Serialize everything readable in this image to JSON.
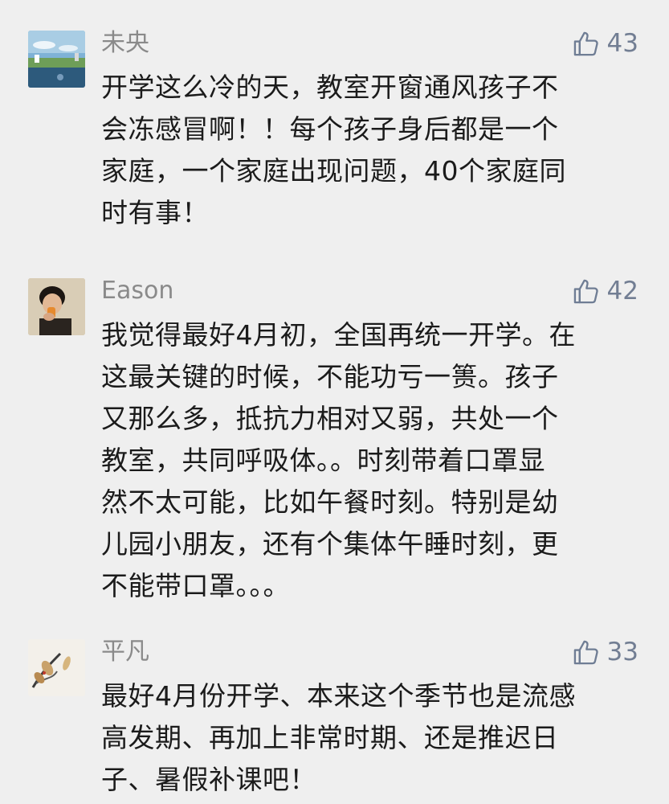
{
  "comments": [
    {
      "username": "未央",
      "likes": "43",
      "avatar": "landscape-sky-avatar",
      "lines": [
        "开学这么冷的天，教室开窗通风孩子不",
        "会冻感冒啊！！每个孩子身后都是一个",
        "家庭，一个家庭出现问题，40个家庭同",
        "时有事！"
      ]
    },
    {
      "username": "Eason",
      "likes": "42",
      "avatar": "person-drinking-avatar",
      "lines": [
        "我觉得最好4月初，全国再统一开学。在",
        "这最关键的时候，不能功亏一篑。孩子",
        "又那么多，抵抗力相对又弱，共处一个",
        "教室，共同呼吸体。。时刻带着口罩显",
        "然不太可能，比如午餐时刻。特别是幼",
        "儿园小朋友，还有个集体午睡时刻，更",
        "不能带口罩。。。"
      ]
    },
    {
      "username": "平凡",
      "likes": "33",
      "avatar": "ink-painting-avatar",
      "lines": [
        "最好4月份开学、本来这个季节也是流感",
        "高发期、再加上非常时期、还是推迟日",
        "子、暑假补课吧！"
      ]
    }
  ],
  "colors": {
    "background": "#efefef",
    "username": "#8a8a8a",
    "like": "#727e93",
    "text": "#1b1b1b"
  }
}
